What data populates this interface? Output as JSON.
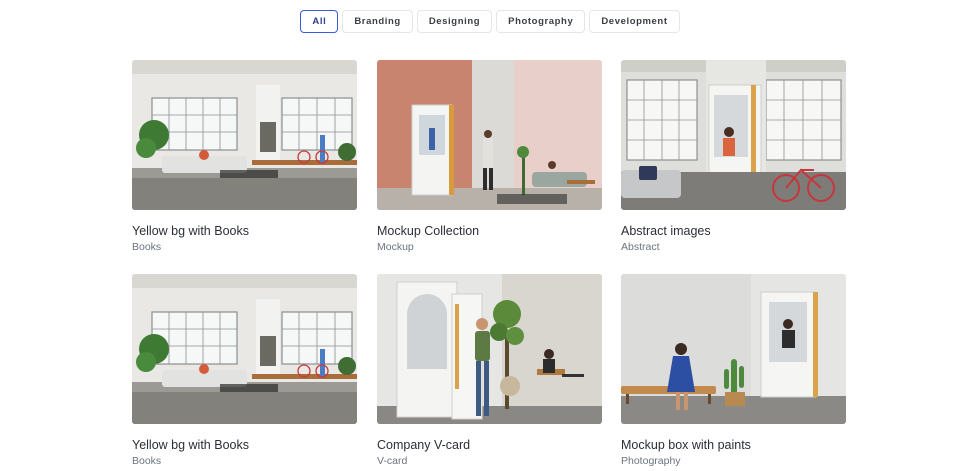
{
  "filters": [
    {
      "label": "All",
      "active": true
    },
    {
      "label": "Branding",
      "active": false
    },
    {
      "label": "Designing",
      "active": false
    },
    {
      "label": "Photography",
      "active": false
    },
    {
      "label": "Development",
      "active": false
    }
  ],
  "portfolio": {
    "items": [
      {
        "title": "Yellow bg with Books",
        "category": "Books",
        "image": "loft-office-photo"
      },
      {
        "title": "Mockup Collection",
        "category": "Mockup",
        "image": "pink-room-booth-photo"
      },
      {
        "title": "Abstract images",
        "category": "Abstract",
        "image": "booth-with-bicycle-photo"
      },
      {
        "title": "Yellow bg with Books",
        "category": "Books",
        "image": "loft-office-photo"
      },
      {
        "title": "Company V-card",
        "category": "V-card",
        "image": "man-at-booth-door-photo"
      },
      {
        "title": "Mockup box with paints",
        "category": "Photography",
        "image": "woman-on-bench-photo"
      }
    ]
  }
}
